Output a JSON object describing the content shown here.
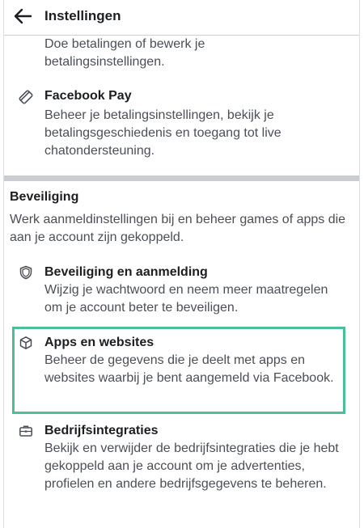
{
  "header": {
    "title": "Instellingen",
    "back_icon": "arrow-left-icon"
  },
  "payments_partial": {
    "description": "Doe betalingen of bewerk je betalingsinstellingen."
  },
  "facebook_pay": {
    "icon": "credit-card-icon",
    "title": "Facebook Pay",
    "description": "Beheer je betalingsinstellingen, bekijk je betalingsgeschiedenis en toegang tot live chatondersteuning."
  },
  "security_section": {
    "title": "Beveiliging",
    "description": "Werk aanmeldinstellingen bij en beheer games of apps die aan je account zijn gekoppeld.",
    "items": [
      {
        "icon": "shield-icon",
        "title": "Beveiliging en aanmelding",
        "description": "Wijzig je wachtwoord en neem meer maatregelen om je account beter te beveiligen."
      },
      {
        "icon": "cube-icon",
        "title": "Apps en websites",
        "description": "Beheer de gegevens die je deelt met apps en websites waarbij je bent aangemeld via Facebook.",
        "highlighted": true
      },
      {
        "icon": "briefcase-icon",
        "title": "Bedrijfsintegraties",
        "description": "Bekijk en verwijder de bedrijfsintegraties die je hebt gekoppeld aan je account om je advertenties, profielen en andere bedrijfsgegevens te beheren."
      }
    ]
  },
  "colors": {
    "highlight_border": "#4dbf96",
    "divider": "#c9ccd1",
    "secondary_text": "#4b4f56"
  }
}
